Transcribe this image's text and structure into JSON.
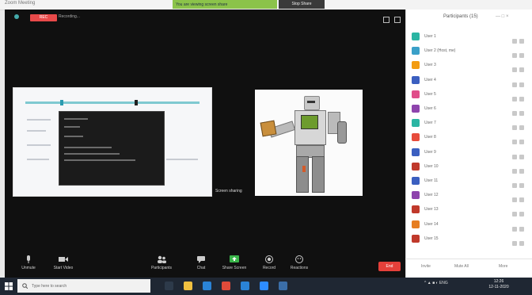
{
  "window": {
    "title": "Zoom Meeting"
  },
  "share_banner": {
    "text": "You are viewing screen share",
    "stop_label": "Stop Share"
  },
  "recording": {
    "badge": "REC",
    "label": "Recording..."
  },
  "shared_screen": {
    "label": "Screen sharing"
  },
  "toolbar": {
    "items": [
      {
        "label": "Unmute",
        "icon": "mic-icon"
      },
      {
        "label": "Start Video",
        "icon": "video-icon"
      },
      {
        "label": "Participants",
        "icon": "participants-icon"
      },
      {
        "label": "Chat",
        "icon": "chat-icon"
      },
      {
        "label": "Share Screen",
        "icon": "share-screen-icon"
      },
      {
        "label": "Record",
        "icon": "record-icon"
      },
      {
        "label": "Reactions",
        "icon": "reactions-icon"
      }
    ],
    "end_label": "End"
  },
  "participants_panel": {
    "title": "Participants (15)",
    "header_icons": "— □ ×",
    "participants": [
      {
        "name": "User 1",
        "color": "#2bb5a3"
      },
      {
        "name": "User 2 (Host, me)",
        "color": "#3aa0c8"
      },
      {
        "name": "User 3",
        "color": "#f39c12"
      },
      {
        "name": "User 4",
        "color": "#3b5fc0"
      },
      {
        "name": "User 5",
        "color": "#e04e8a"
      },
      {
        "name": "User 6",
        "color": "#8e44ad"
      },
      {
        "name": "User 7",
        "color": "#2bb5a3"
      },
      {
        "name": "User 8",
        "color": "#e74c3c"
      },
      {
        "name": "User 9",
        "color": "#3b5fc0"
      },
      {
        "name": "User 10",
        "color": "#c0392b"
      },
      {
        "name": "User 11",
        "color": "#3b5fc0"
      },
      {
        "name": "User 12",
        "color": "#8e44ad"
      },
      {
        "name": "User 13",
        "color": "#c0392b"
      },
      {
        "name": "User 14",
        "color": "#e67e22"
      },
      {
        "name": "User 15",
        "color": "#c0392b"
      }
    ],
    "footer": {
      "invite": "Invite",
      "mute_all": "Mute All",
      "more": "More"
    }
  },
  "taskbar": {
    "search_placeholder": "Type here to search",
    "tray_text": "^ ▲ ■ ◐ ENG",
    "time": "12:26",
    "date": "12-11-2020",
    "apps": [
      {
        "icon": "task-view-icon",
        "color": "#2d3a4a"
      },
      {
        "icon": "file-explorer-icon",
        "color": "#f0c040"
      },
      {
        "icon": "edge-icon",
        "color": "#2a83d6"
      },
      {
        "icon": "chrome-icon",
        "color": "#e04b3a"
      },
      {
        "icon": "mail-icon",
        "color": "#2a83d6"
      },
      {
        "icon": "zoom-icon",
        "color": "#2d8cff"
      },
      {
        "icon": "store-icon",
        "color": "#3b6ea8"
      }
    ]
  }
}
